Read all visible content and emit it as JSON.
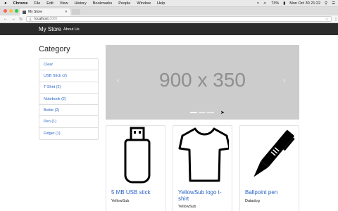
{
  "macos": {
    "apple": "",
    "app": "Chrome",
    "menus": [
      "File",
      "Edit",
      "View",
      "History",
      "Bookmarks",
      "People",
      "Window",
      "Help"
    ],
    "battery": "73%",
    "clock": "Mon Oct 30  21:22"
  },
  "browser": {
    "tab_title": "My Store",
    "url_host": "localhost",
    "url_port": ":3000"
  },
  "navbar": {
    "brand": "My Store",
    "about": "About Us"
  },
  "sidebar": {
    "title": "Category",
    "items": [
      {
        "label": "Clear"
      },
      {
        "label": "USB Stick (2)"
      },
      {
        "label": "T-Shirt (2)"
      },
      {
        "label": "Notebook (2)"
      },
      {
        "label": "Bottle (2)"
      },
      {
        "label": "Pen (1)"
      },
      {
        "label": "Fidget (1)"
      }
    ]
  },
  "carousel": {
    "placeholder": "900 x 350",
    "prev": "‹",
    "next": "›",
    "slide_count": 3,
    "active_slide": 1
  },
  "products": [
    {
      "title": "5 MB USB stick",
      "vendor": "YellowSub",
      "icon": "usb-stick-icon"
    },
    {
      "title": "YellowSub logo t-shirt",
      "vendor": "YellowSub",
      "icon": "tshirt-icon"
    },
    {
      "title": "Ballpoint pen",
      "vendor": "Datadog",
      "icon": "pen-icon"
    }
  ]
}
